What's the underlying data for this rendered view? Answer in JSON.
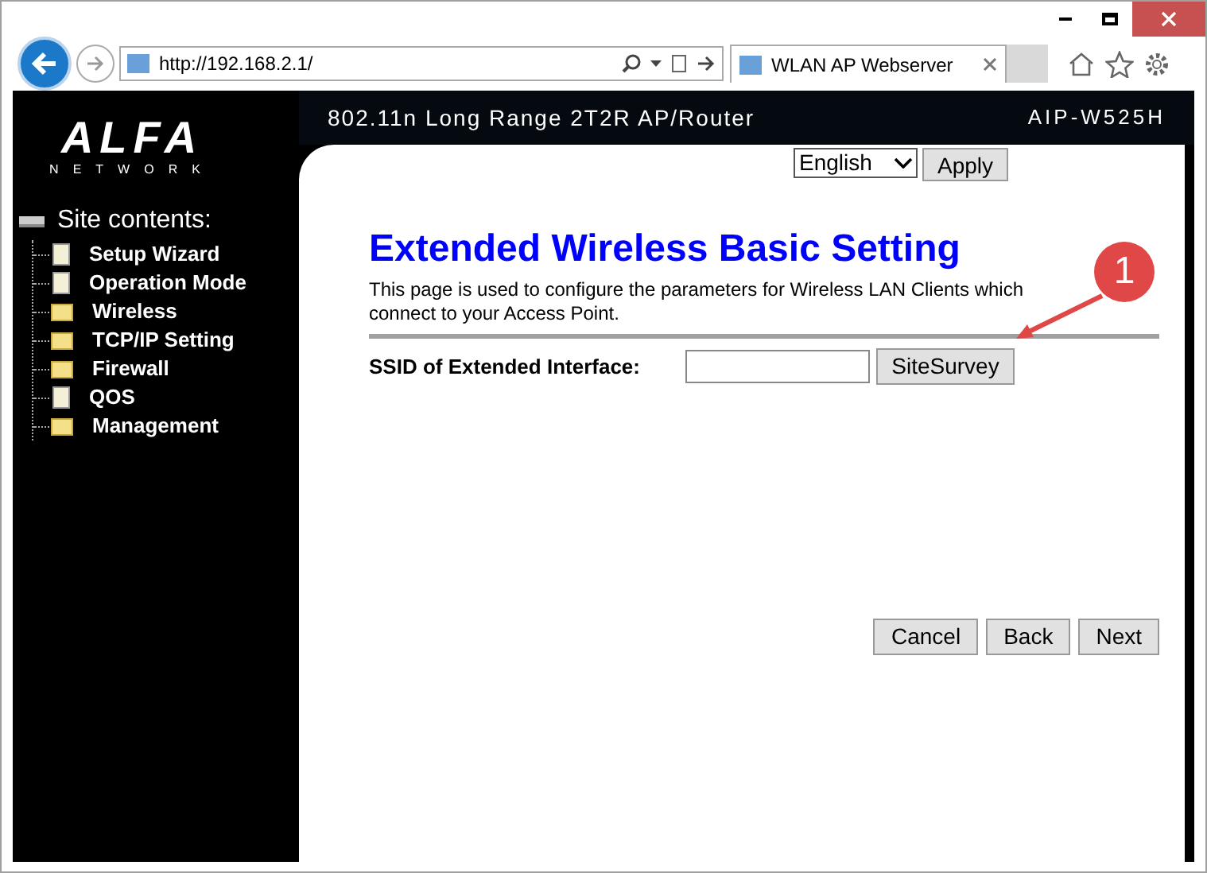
{
  "browser": {
    "address": "http://192.168.2.1/",
    "tab_title": "WLAN AP Webserver"
  },
  "header": {
    "logo": "ALFA",
    "logo_sub": "NETWORK",
    "tagline": "802.11n Long Range 2T2R AP/Router",
    "model": "AIP-W525H"
  },
  "language": {
    "value": "English",
    "apply": "Apply"
  },
  "sidebar": {
    "title": "Site contents:",
    "items": [
      {
        "label": "Setup Wizard",
        "kind": "page"
      },
      {
        "label": "Operation Mode",
        "kind": "page"
      },
      {
        "label": "Wireless",
        "kind": "folder"
      },
      {
        "label": "TCP/IP Setting",
        "kind": "folder"
      },
      {
        "label": "Firewall",
        "kind": "folder"
      },
      {
        "label": "QOS",
        "kind": "page"
      },
      {
        "label": "Management",
        "kind": "folder"
      }
    ]
  },
  "page": {
    "title": "Extended Wireless Basic Setting",
    "description_lines": [
      "This page is used to configure the parameters for Wireless LAN Clients which",
      "connect to your Access Point."
    ],
    "ssid_label": "SSID of Extended Interface:",
    "site_survey": "SiteSurvey",
    "buttons": [
      "Cancel",
      "Back",
      "Next"
    ]
  },
  "callout": {
    "label": "1"
  }
}
